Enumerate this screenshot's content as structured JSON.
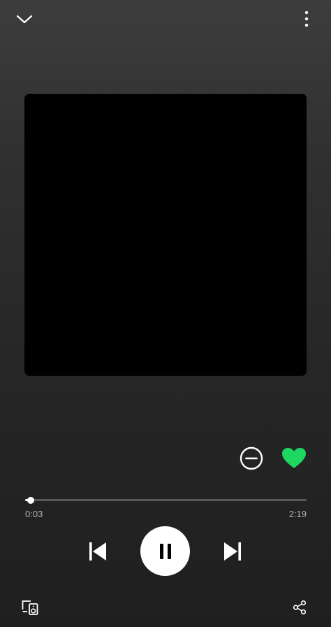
{
  "player": {
    "elapsed": "0:03",
    "duration": "2:19",
    "progress_fraction": 0.02,
    "is_playing": true,
    "liked": true
  },
  "colors": {
    "accent_green": "#1ed760",
    "background_top": "#3d3d3d",
    "background_bottom": "#1f1f1f",
    "track": "#5a5a5a",
    "time_text": "#b3b3b3"
  },
  "icons": {
    "collapse": "chevron-down-icon",
    "more": "more-vertical-icon",
    "remove": "minus-circle-icon",
    "like": "heart-filled-icon",
    "previous": "skip-previous-icon",
    "pause": "pause-icon",
    "next": "skip-next-icon",
    "devices": "connect-device-icon",
    "share": "share-icon"
  }
}
